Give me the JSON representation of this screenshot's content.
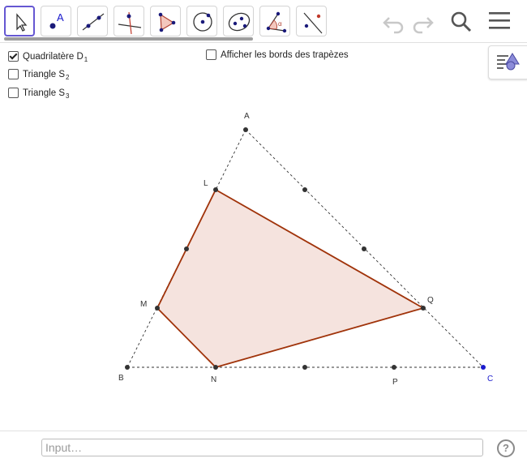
{
  "toolbar": {
    "tools": [
      {
        "name": "move-tool",
        "icon": "arrow-pointer-icon"
      },
      {
        "name": "point-tool",
        "icon": "point-icon",
        "label": "A"
      },
      {
        "name": "line-tool",
        "icon": "line-through-two-points-icon"
      },
      {
        "name": "perpendicular-line-tool",
        "icon": "perpendicular-line-icon"
      },
      {
        "name": "polygon-tool",
        "icon": "polygon-icon"
      },
      {
        "name": "circle-tool",
        "icon": "circle-center-point-icon"
      },
      {
        "name": "ellipse-tool",
        "icon": "conic-through-points-icon"
      },
      {
        "name": "angle-tool",
        "icon": "angle-icon",
        "label": "α"
      },
      {
        "name": "reflect-tool",
        "icon": "reflect-about-line-icon"
      }
    ],
    "undo_icon": "undo-icon",
    "redo_icon": "redo-icon",
    "search_icon": "search-icon",
    "menu_icon": "hamburger-menu-icon"
  },
  "checkboxes": [
    {
      "label": "Quadrilatère D",
      "sub": "1",
      "checked": true
    },
    {
      "label": "Triangle S",
      "sub": "2",
      "checked": false
    },
    {
      "label": "Triangle S",
      "sub": "3",
      "checked": false
    },
    {
      "label": "Afficher les bords des trapèzes",
      "sub": "",
      "checked": false
    }
  ],
  "style_bar_icon": "style-bar-toggle-icon",
  "points": {
    "A": "A",
    "B": "B",
    "C": "C",
    "L": "L",
    "M": "M",
    "N": "N",
    "P": "P",
    "Q": "Q"
  },
  "colors": {
    "polygon_stroke": "#a0330a",
    "polygon_fill": "#f5e3de",
    "point_fill": "#333333",
    "point_c": "#1a1acc",
    "tool_active_border": "#6557d2"
  },
  "input_bar": {
    "placeholder": "Input…"
  },
  "help_icon": "help-icon",
  "help_label": "?"
}
